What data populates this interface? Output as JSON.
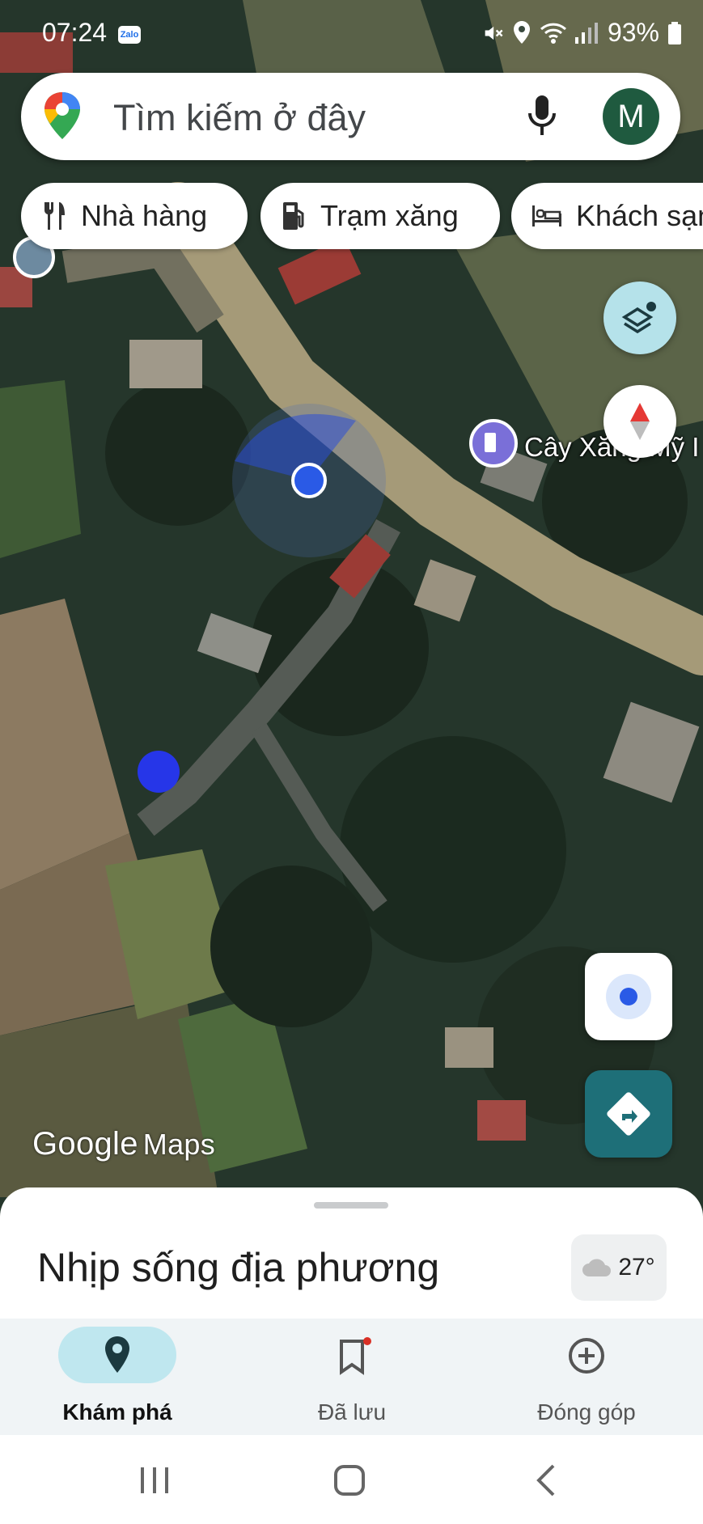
{
  "status_bar": {
    "time": "07:24",
    "notif_app": "Zalo",
    "battery": "93%"
  },
  "search": {
    "placeholder": "Tìm kiếm ở đây",
    "avatar_initial": "M"
  },
  "chips": [
    "Nhà hàng",
    "Trạm xăng",
    "Khách sạn"
  ],
  "map": {
    "poi_label": "Cây Xăng Mỹ I",
    "logo_google": "Google",
    "logo_maps": "Maps"
  },
  "sheet": {
    "title": "Nhịp sống địa phương",
    "weather_temp": "27°"
  },
  "nav": {
    "explore": "Khám phá",
    "saved": "Đã lưu",
    "contribute": "Đóng góp"
  },
  "colors": {
    "accent": "#1e6f78",
    "nav_active": "#bfe7ef",
    "location_blue": "#2c5be8"
  },
  "icons": [
    "maps-pin-icon",
    "mic-icon",
    "fork-knife-icon",
    "gas-pump-icon",
    "bed-icon",
    "layers-icon",
    "compass-icon",
    "my-location-icon",
    "directions-icon",
    "explore-pin-icon",
    "bookmark-icon",
    "add-circle-icon"
  ]
}
